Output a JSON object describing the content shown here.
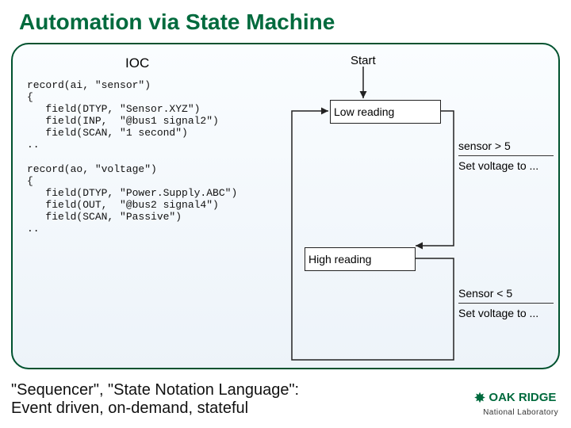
{
  "title": "Automation via State Machine",
  "ioc_label": "IOC",
  "code_block": "record(ai, \"sensor\")\n{\n   field(DTYP, \"Sensor.XYZ\")\n   field(INP,  \"@bus1 signal2\")\n   field(SCAN, \"1 second\")\n..\n\nrecord(ao, \"voltage\")\n{\n   field(DTYP, \"Power.Supply.ABC\")\n   field(OUT,  \"@bus2 signal4\")\n   field(SCAN, \"Passive\")\n..",
  "start_label": "Start",
  "state_low": "Low reading",
  "state_high": "High reading",
  "trans1_cond": "sensor > 5",
  "trans1_action": "Set voltage to ...",
  "trans2_cond": "Sensor < 5",
  "trans2_action": "Set voltage to ...",
  "footer_line1": "\"Sequencer\", \"State Notation Language\":",
  "footer_line2": "Event driven, on-demand, stateful",
  "logo_main": "OAK RIDGE",
  "logo_sub": "National Laboratory"
}
